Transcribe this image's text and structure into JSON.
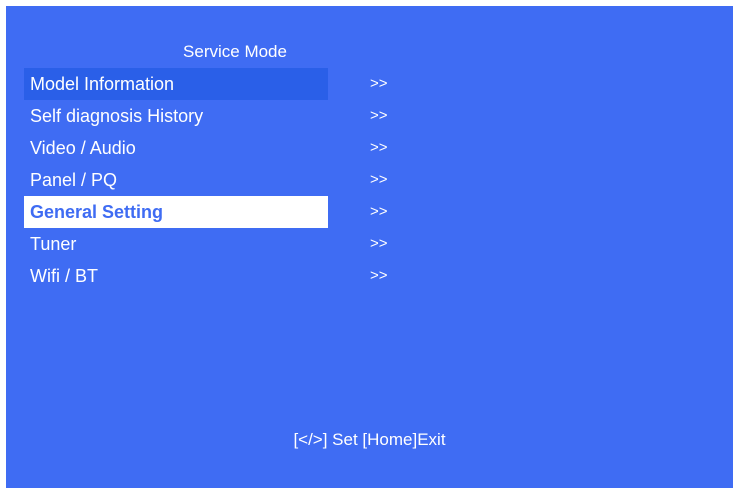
{
  "title": "Service Mode",
  "menu": {
    "items": [
      {
        "label": "Model Information",
        "arrow": ">>",
        "state": "hover"
      },
      {
        "label": "Self diagnosis History",
        "arrow": ">>",
        "state": "normal"
      },
      {
        "label": "Video / Audio",
        "arrow": ">>",
        "state": "normal"
      },
      {
        "label": "Panel / PQ",
        "arrow": ">>",
        "state": "normal"
      },
      {
        "label": "General Setting",
        "arrow": ">>",
        "state": "selected"
      },
      {
        "label": "Tuner",
        "arrow": ">>",
        "state": "normal"
      },
      {
        "label": "Wifi / BT",
        "arrow": ">>",
        "state": "normal"
      }
    ]
  },
  "footer": "[</>] Set [Home]Exit",
  "colors": {
    "background": "#3f6cf3",
    "hover_bar": "#2a5fe8",
    "selected_bar": "#ffffff",
    "text": "#ffffff"
  }
}
